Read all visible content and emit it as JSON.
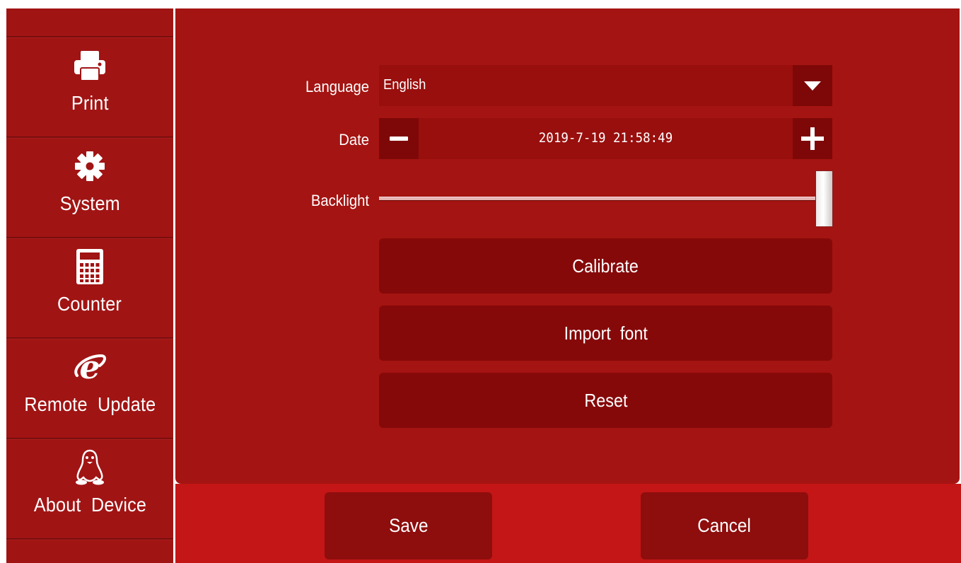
{
  "sidebar": {
    "items": [
      {
        "label": "Print",
        "icon": "printer-icon"
      },
      {
        "label": "System",
        "icon": "gear-icon"
      },
      {
        "label": "Counter",
        "icon": "calculator-icon"
      },
      {
        "label": "Remote  Update",
        "icon": "internet-explorer-icon"
      },
      {
        "label": "About  Device",
        "icon": "penguin-icon"
      }
    ]
  },
  "settings": {
    "language": {
      "label": "Language",
      "value": "English"
    },
    "date": {
      "label": "Date",
      "value": "2019-7-19  21:58:49"
    },
    "backlight": {
      "label": "Backlight",
      "level": 1.0
    }
  },
  "actions": {
    "calibrate": "Calibrate",
    "import_font": "Import  font",
    "reset": "Reset"
  },
  "footer": {
    "save": "Save",
    "cancel": "Cancel"
  },
  "colors": {
    "sidebar_bg": "#a11414",
    "panel_bg": "#a41412",
    "button_bg": "#860909",
    "footer_bg": "#c41616"
  }
}
